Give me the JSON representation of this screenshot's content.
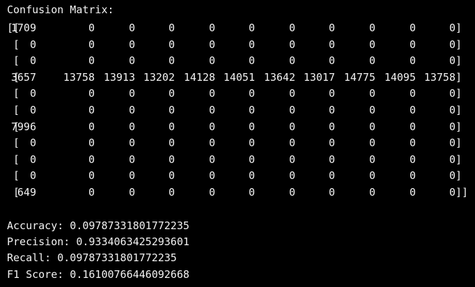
{
  "header": "Confusion Matrix:",
  "matrix": [
    [
      "1709",
      "0",
      "0",
      "0",
      "0",
      "0",
      "0",
      "0",
      "0",
      "0",
      "0"
    ],
    [
      "0",
      "0",
      "0",
      "0",
      "0",
      "0",
      "0",
      "0",
      "0",
      "0",
      "0"
    ],
    [
      "0",
      "0",
      "0",
      "0",
      "0",
      "0",
      "0",
      "0",
      "0",
      "0",
      "0"
    ],
    [
      "3657",
      "13758",
      "13913",
      "13202",
      "14128",
      "14051",
      "13642",
      "13017",
      "14775",
      "14095",
      "13758"
    ],
    [
      "0",
      "0",
      "0",
      "0",
      "0",
      "0",
      "0",
      "0",
      "0",
      "0",
      "0"
    ],
    [
      "0",
      "0",
      "0",
      "0",
      "0",
      "0",
      "0",
      "0",
      "0",
      "0",
      "0"
    ],
    [
      "7996",
      "0",
      "0",
      "0",
      "0",
      "0",
      "0",
      "0",
      "0",
      "0",
      "0"
    ],
    [
      "0",
      "0",
      "0",
      "0",
      "0",
      "0",
      "0",
      "0",
      "0",
      "0",
      "0"
    ],
    [
      "0",
      "0",
      "0",
      "0",
      "0",
      "0",
      "0",
      "0",
      "0",
      "0",
      "0"
    ],
    [
      "0",
      "0",
      "0",
      "0",
      "0",
      "0",
      "0",
      "0",
      "0",
      "0",
      "0"
    ],
    [
      "649",
      "0",
      "0",
      "0",
      "0",
      "0",
      "0",
      "0",
      "0",
      "0",
      "0"
    ]
  ],
  "open_first": "[[",
  "open_other": "[",
  "close_row": "]",
  "close_last": "]]",
  "metrics": {
    "accuracy": "Accuracy: 0.09787331801772235",
    "precision": "Precision: 0.9334063425293601",
    "recall": "Recall: 0.09787331801772235",
    "f1": "F1 Score: 0.16100766446092668"
  }
}
